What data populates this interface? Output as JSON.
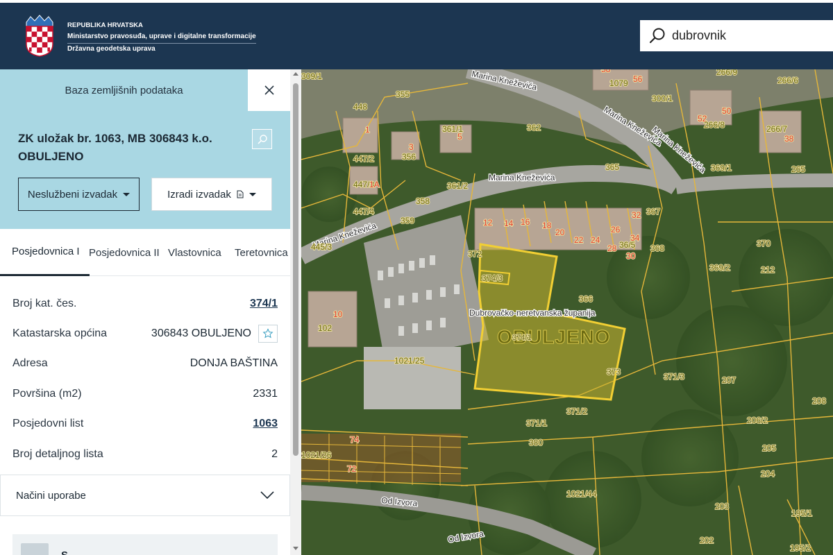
{
  "header": {
    "line1": "REPUBLIKA HRVATSKA",
    "line2": "Ministarstvo pravosuđa, uprave i digitalne transformacije",
    "line3": "Državna geodetska uprava",
    "search_value": "dubrovnik"
  },
  "sidebar": {
    "title": "Baza zemljišnih podataka",
    "heading_line1": "ZK uložak br. 1063, MB 306843 k.o.",
    "heading_line2": "OBULJENO",
    "btn_unofficial": "Neslužbeni izvadak",
    "btn_create": "Izradi izvadak",
    "tabs": [
      "Posjedovnica I",
      "Posjedovnica II",
      "Vlastovnica",
      "Teretovnica"
    ],
    "rows": [
      {
        "label": "Broj kat. čes.",
        "value": "374/1"
      },
      {
        "label": "Katastarska općina",
        "value": "306843 OBULJENO"
      },
      {
        "label": "Adresa",
        "value": "DONJA BAŠTINA"
      },
      {
        "label": "Površina (m2)",
        "value": "2331"
      },
      {
        "label": "Posjedovni list",
        "value": "1063"
      },
      {
        "label": "Broj detaljnog lista",
        "value": "2"
      }
    ],
    "accordion_label": "Načini uporabe",
    "card_text": "S... ..."
  },
  "map": {
    "streets": [
      "Marina Kneževića",
      "Marina Kneževića",
      "Marina Kneževića",
      "Marina Kneževića",
      "Marina Kneževića",
      "Od Izvora",
      "Od Izvora"
    ],
    "region_label": "Dubrovačko-neretvanska županija",
    "municipality_label": "OBULJENO",
    "parcels": [
      "309/1",
      "1079",
      "56",
      "58",
      "266/9",
      "266/6",
      "355",
      "300/1",
      "448",
      "361/1",
      "362",
      "50",
      "52",
      "266/8",
      "266/7",
      "38",
      "447/2",
      "365",
      "369/1",
      "265",
      "1",
      "5",
      "3",
      "356",
      "447/3",
      "1A",
      "361/2",
      "358",
      "367",
      "447/4",
      "359",
      "12",
      "14",
      "16",
      "18",
      "20",
      "22",
      "24",
      "26",
      "28",
      "30",
      "32",
      "34",
      "36/5",
      "368",
      "370",
      "445/3",
      "372",
      "374/3",
      "366",
      "369/2",
      "212",
      "10",
      "102",
      "371/3",
      "207",
      "208",
      "1021/25",
      "373",
      "371/2",
      "206/2",
      "371/1",
      "380",
      "205",
      "74",
      "204",
      "1021/26",
      "72",
      "1021/44",
      "203",
      "195/1",
      "202",
      "195/2",
      "374/1"
    ],
    "colors": {
      "parcel_line": "#e6b73a",
      "selected_fill": "#c9b430",
      "selected_line": "#f2cf33",
      "label_red": "#e23b2e",
      "label_olive": "#6b6a12"
    }
  }
}
